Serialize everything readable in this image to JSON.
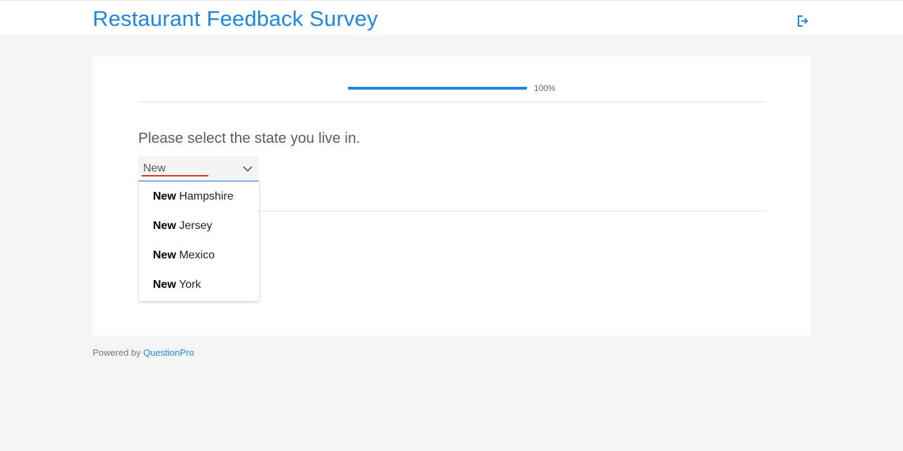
{
  "header": {
    "title": "Restaurant Feedback Survey",
    "exit_icon": "exit-icon"
  },
  "progress": {
    "value": 1.0,
    "label": "100%",
    "color": "#1b87e6"
  },
  "question": {
    "text": "Please select the state you live in.",
    "input_value": "New",
    "chevron_icon": "chevron-down-icon"
  },
  "dropdown": {
    "match": "New",
    "options": [
      {
        "match": "New",
        "rest": " Hampshire"
      },
      {
        "match": "New",
        "rest": " Jersey"
      },
      {
        "match": "New",
        "rest": " Mexico"
      },
      {
        "match": "New",
        "rest": " York"
      }
    ]
  },
  "footer": {
    "prefix": "Powered by",
    "link": "QuestionPro"
  },
  "colors": {
    "accent": "#1b87e6",
    "background": "#f5f5f5",
    "spellcheck": "#d9322c"
  }
}
